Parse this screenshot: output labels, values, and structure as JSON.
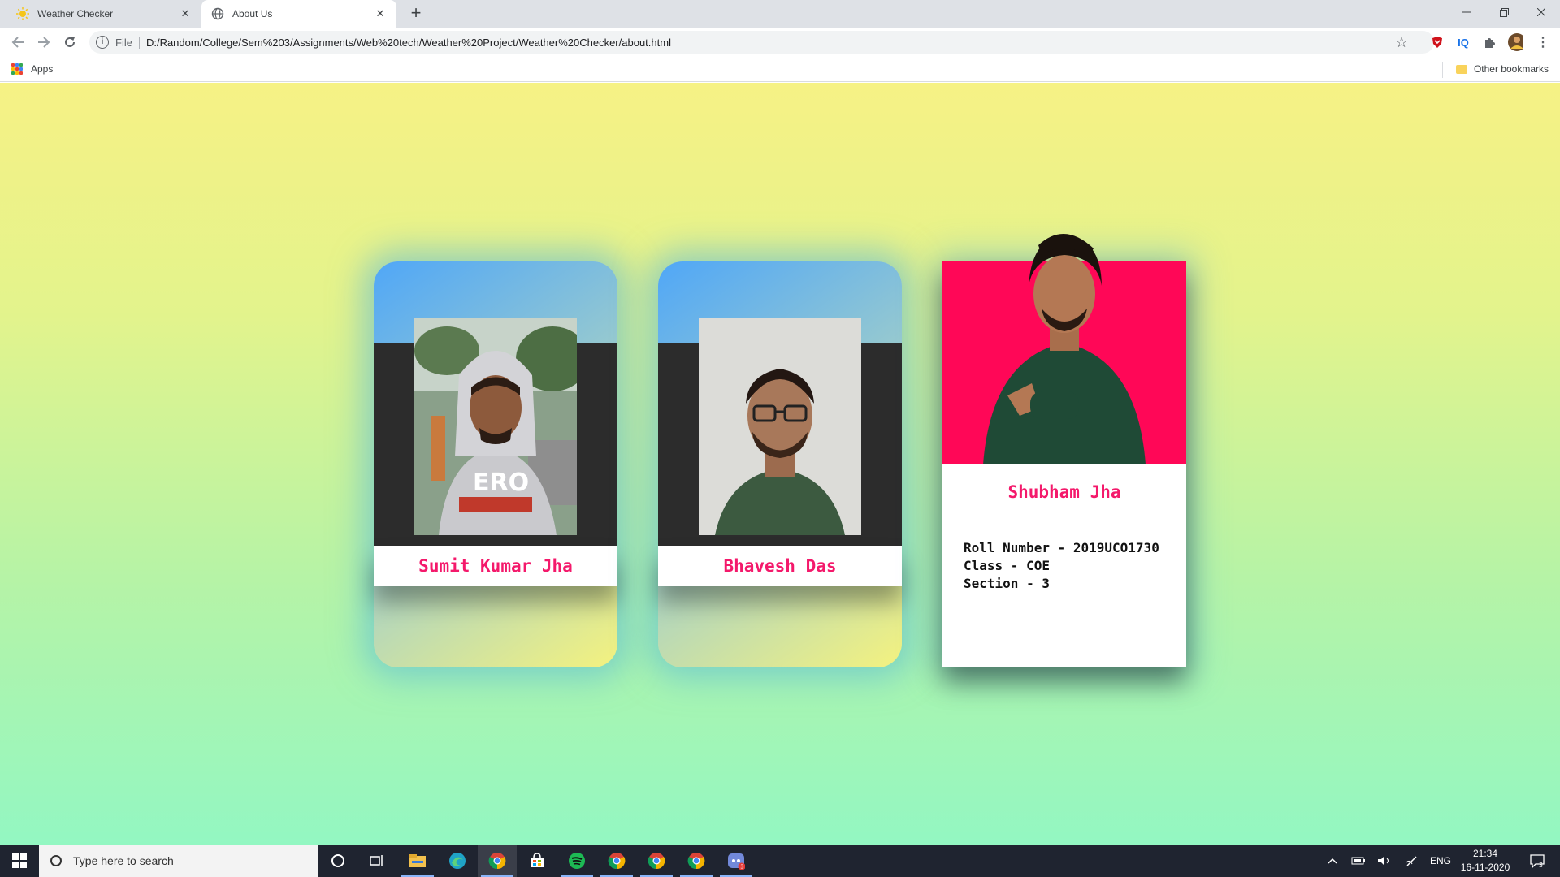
{
  "browser": {
    "tabs": [
      {
        "label": "Weather Checker",
        "icon": "sun-icon",
        "active": false
      },
      {
        "label": "About Us",
        "icon": "globe-icon",
        "active": true
      }
    ],
    "address": {
      "scheme": "File",
      "url": "D:/Random/College/Sem%203/Assignments/Web%20tech/Weather%20Project/Weather%20Checker/about.html"
    },
    "bookmarks": {
      "apps_label": "Apps",
      "other_label": "Other bookmarks"
    },
    "extensions": [
      "shield-extension-icon",
      "iq-extension-icon",
      "puzzle-extensions-icon",
      "profile-avatar"
    ],
    "iq_label": "IQ"
  },
  "page": {
    "background_top": "#f6f285",
    "background_bottom": "#93f7c2",
    "accent": "#f4196b",
    "members": [
      {
        "name": "Sumit Kumar Jha",
        "photo": "photo of young man in grey hoodie outdoors"
      },
      {
        "name": "Bhavesh Das",
        "photo": "photo of young man with glasses"
      },
      {
        "name": "Shubham Jha",
        "photo": "photo of young man in green shirt pointing",
        "details": [
          "Roll Number - 2019UCO1730",
          "Class - COE",
          "Section - 3"
        ]
      }
    ]
  },
  "taskbar": {
    "search_placeholder": "Type here to search",
    "language": "ENG",
    "time": "21:34",
    "date": "16-11-2020",
    "notification_count": "3",
    "discord_badge": "3"
  }
}
